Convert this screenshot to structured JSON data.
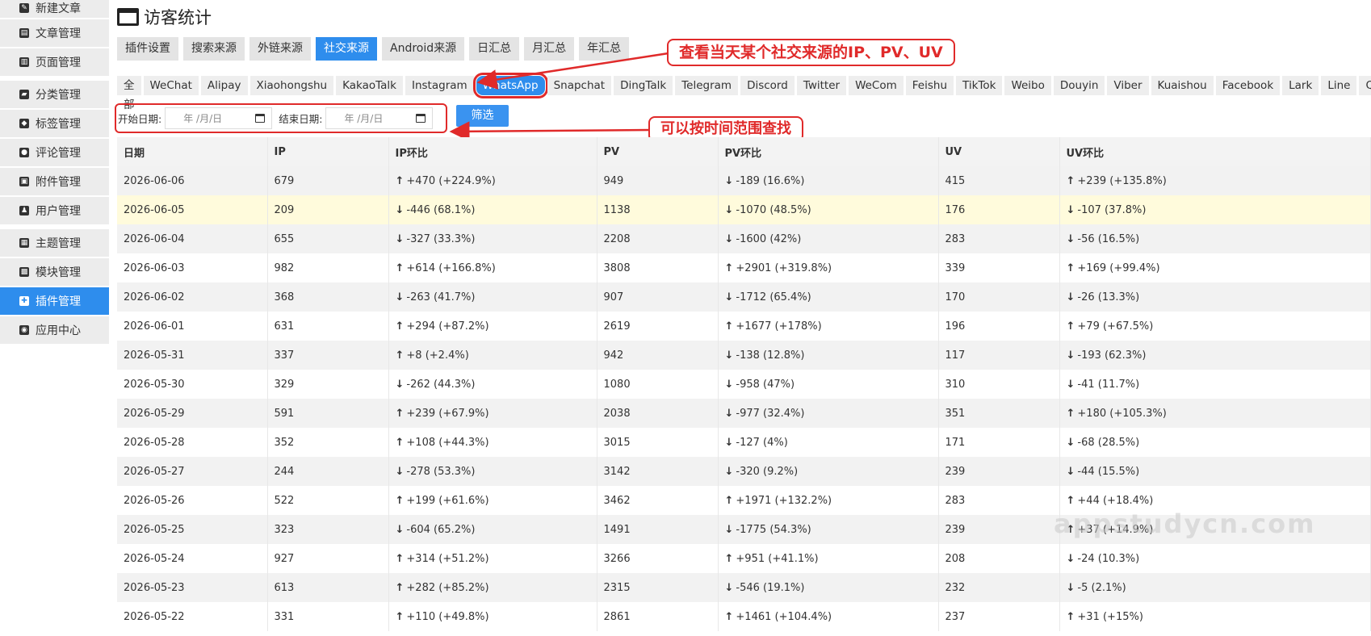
{
  "sidebar": {
    "items": [
      {
        "label": "新建文章",
        "icon": "edit-icon",
        "active": false
      },
      {
        "label": "文章管理",
        "icon": "archive-icon",
        "active": false
      },
      {
        "label": "页面管理",
        "icon": "file-icon",
        "active": false
      },
      {
        "label": "分类管理",
        "icon": "folder-icon",
        "active": false
      },
      {
        "label": "标签管理",
        "icon": "tag-icon",
        "active": false
      },
      {
        "label": "评论管理",
        "icon": "comment-icon",
        "active": false
      },
      {
        "label": "附件管理",
        "icon": "inbox-icon",
        "active": false
      },
      {
        "label": "用户管理",
        "icon": "users-icon",
        "active": false
      },
      {
        "label": "主题管理",
        "icon": "layout-icon",
        "active": false
      },
      {
        "label": "模块管理",
        "icon": "grid-icon",
        "active": false
      },
      {
        "label": "插件管理",
        "icon": "puzzle-icon",
        "active": true
      },
      {
        "label": "应用中心",
        "icon": "app-icon",
        "active": false
      }
    ]
  },
  "page": {
    "title": "访客统计"
  },
  "tabs": [
    "插件设置",
    "搜索来源",
    "外链来源",
    "社交来源",
    "Android来源",
    "日汇总",
    "月汇总",
    "年汇总"
  ],
  "active_tab": "社交来源",
  "sources": [
    "全部",
    "WeChat",
    "Alipay",
    "Xiaohongshu",
    "KakaoTalk",
    "Instagram",
    "WhatsApp",
    "Snapchat",
    "DingTalk",
    "Telegram",
    "Discord",
    "Twitter",
    "WeCom",
    "Feishu",
    "TikTok",
    "Weibo",
    "Douyin",
    "Viber",
    "Kuaishou",
    "Facebook",
    "Lark",
    "Line",
    "QQ"
  ],
  "active_source": "WhatsApp",
  "filter": {
    "start_label": "开始日期:",
    "end_label": "结束日期:",
    "start_placeholder": "年 /月/日",
    "end_placeholder": "年 /月/日",
    "button": "筛选"
  },
  "callouts": {
    "source": "查看当天某个社交来源的IP、PV、UV",
    "range": "可以按时间范围查找"
  },
  "table": {
    "headers": [
      "日期",
      "IP",
      "IP环比",
      "PV",
      "PV环比",
      "UV",
      "UV环比"
    ],
    "rows": [
      [
        "2026-06-06",
        "679",
        "+470 (+224.9%)",
        "949",
        "-189 (16.6%)",
        "415",
        "+239 (+135.8%)"
      ],
      [
        "2026-06-05",
        "209",
        "-446 (68.1%)",
        "1138",
        "-1070 (48.5%)",
        "176",
        "-107 (37.8%)"
      ],
      [
        "2026-06-04",
        "655",
        "-327 (33.3%)",
        "2208",
        "-1600 (42%)",
        "283",
        "-56 (16.5%)"
      ],
      [
        "2026-06-03",
        "982",
        "+614 (+166.8%)",
        "3808",
        "+2901 (+319.8%)",
        "339",
        "+169 (+99.4%)"
      ],
      [
        "2026-06-02",
        "368",
        "-263 (41.7%)",
        "907",
        "-1712 (65.4%)",
        "170",
        "-26 (13.3%)"
      ],
      [
        "2026-06-01",
        "631",
        "+294 (+87.2%)",
        "2619",
        "+1677 (+178%)",
        "196",
        "+79 (+67.5%)"
      ],
      [
        "2026-05-31",
        "337",
        "+8 (+2.4%)",
        "942",
        "-138 (12.8%)",
        "117",
        "-193 (62.3%)"
      ],
      [
        "2026-05-30",
        "329",
        "-262 (44.3%)",
        "1080",
        "-958 (47%)",
        "310",
        "-41 (11.7%)"
      ],
      [
        "2026-05-29",
        "591",
        "+239 (+67.9%)",
        "2038",
        "-977 (32.4%)",
        "351",
        "+180 (+105.3%)"
      ],
      [
        "2026-05-28",
        "352",
        "+108 (+44.3%)",
        "3015",
        "-127 (4%)",
        "171",
        "-68 (28.5%)"
      ],
      [
        "2026-05-27",
        "244",
        "-278 (53.3%)",
        "3142",
        "-320 (9.2%)",
        "239",
        "-44 (15.5%)"
      ],
      [
        "2026-05-26",
        "522",
        "+199 (+61.6%)",
        "3462",
        "+1971 (+132.2%)",
        "283",
        "+44 (+18.4%)"
      ],
      [
        "2026-05-25",
        "323",
        "-604 (65.2%)",
        "1491",
        "-1775 (54.3%)",
        "239",
        "+37 (+14.9%)"
      ],
      [
        "2026-05-24",
        "927",
        "+314 (+51.2%)",
        "3266",
        "+951 (+41.1%)",
        "208",
        "-24 (10.3%)"
      ],
      [
        "2026-05-23",
        "613",
        "+282 (+85.2%)",
        "2315",
        "-546 (19.1%)",
        "232",
        "-5 (2.1%)"
      ],
      [
        "2026-05-22",
        "331",
        "+110 (+49.8%)",
        "2861",
        "+1461 (+104.4%)",
        "237",
        "+31 (+15%)"
      ]
    ],
    "highlight_row": 1
  },
  "watermark": "appstudycn.com",
  "colors": {
    "accent": "#2e8ded",
    "up": "#2bb52b",
    "down": "#e85151",
    "callout": "#e02a2a"
  }
}
